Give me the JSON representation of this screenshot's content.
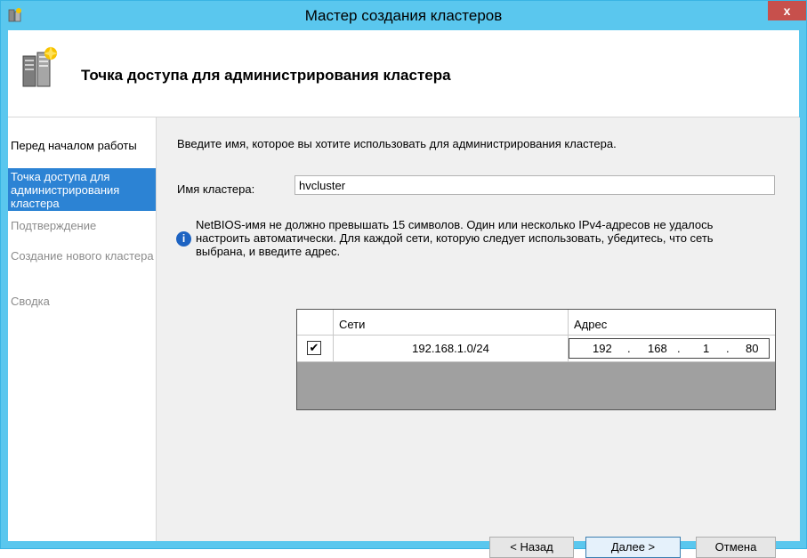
{
  "window": {
    "title": "Мастер создания кластеров",
    "close_label": "x"
  },
  "header": {
    "title": "Точка доступа для администрирования кластера"
  },
  "sidebar": {
    "items": [
      {
        "label": "Перед началом работы",
        "state": "normal"
      },
      {
        "label": "Точка доступа для администрирования кластера",
        "state": "active"
      },
      {
        "label": "Подтверждение",
        "state": "disabled"
      },
      {
        "label": "Создание нового кластера",
        "state": "disabled"
      },
      {
        "label": "Сводка",
        "state": "disabled"
      }
    ]
  },
  "main": {
    "instruction": "Введите имя, которое вы хотите использовать для администрирования кластера.",
    "name_label": "Имя кластера:",
    "name_value": "hvcluster",
    "info_icon": "info-icon",
    "info_text": "NetBIOS-имя не должно превышать 15 символов.  Один или несколько IPv4-адресов не удалось настроить автоматически.  Для каждой сети, которую следует использовать, убедитесь, что сеть выбрана, и введите адрес."
  },
  "grid": {
    "columns": [
      "Сети",
      "Адрес"
    ],
    "rows": [
      {
        "checked": true,
        "check_glyph": "✔",
        "network": "192.168.1.0/24",
        "address": [
          "192",
          "168",
          "1",
          "80"
        ],
        "dot": "."
      }
    ]
  },
  "buttons": {
    "back": "< Назад",
    "next": "Далее >",
    "cancel": "Отмена"
  },
  "colors": {
    "titlebar": "#5ac7ee",
    "active_step": "#2c83d4",
    "close": "#c7504c"
  }
}
